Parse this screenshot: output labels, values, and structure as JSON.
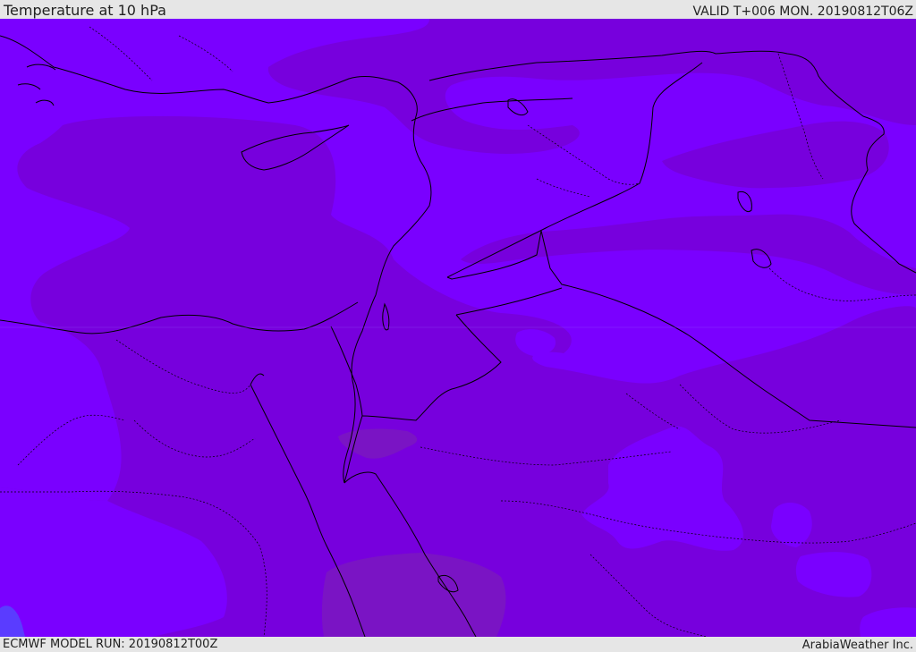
{
  "header": {
    "title": "Temperature at 10 hPa",
    "valid": "VALID T+006 MON. 20190812T06Z"
  },
  "footer": {
    "model_run": "ECMWF MODEL RUN: 20190812T00Z",
    "credit": "ArabiaWeather Inc."
  },
  "map": {
    "colors": {
      "band_light": "#7a00ff",
      "band_mid": "#7700dd",
      "band_dark": "#7a14c4",
      "band_blue": "#5a3cff",
      "boundary": "#000000"
    }
  }
}
